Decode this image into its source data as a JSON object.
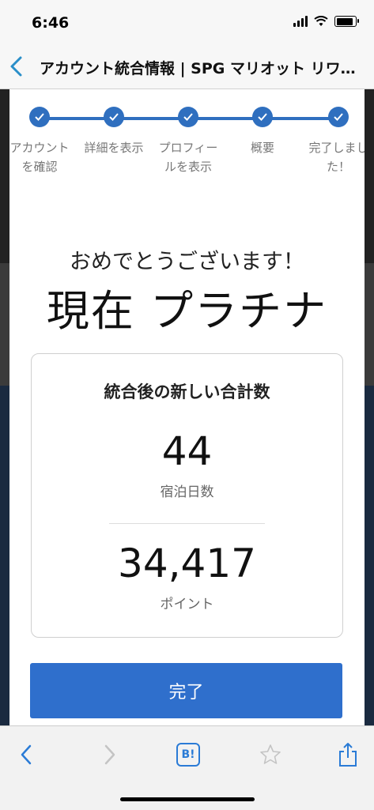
{
  "status_bar": {
    "time": "6:46"
  },
  "nav": {
    "title": "アカウント統合情報 | SPG マリオット リワ…"
  },
  "steps": [
    {
      "label_line1": "アカウント",
      "label_line2": "を確認"
    },
    {
      "label_line1": "詳細を表示",
      "label_line2": ""
    },
    {
      "label_line1": "プロフィー",
      "label_line2": "ルを表示"
    },
    {
      "label_line1": "概要",
      "label_line2": ""
    },
    {
      "label_line1": "完了しまし",
      "label_line2": "た！"
    }
  ],
  "congrats": "おめでとうございます！",
  "tier": "現在 プラチナ",
  "totals": {
    "title": "統合後の新しい合計数",
    "nights_value": "44",
    "nights_label": "宿泊日数",
    "points_value": "34,417",
    "points_label": "ポイント"
  },
  "done_button": "完了",
  "toolbar": {
    "hatena_label": "B!"
  },
  "colors": {
    "accent": "#2f6fbf",
    "button": "#2f6fcc"
  }
}
